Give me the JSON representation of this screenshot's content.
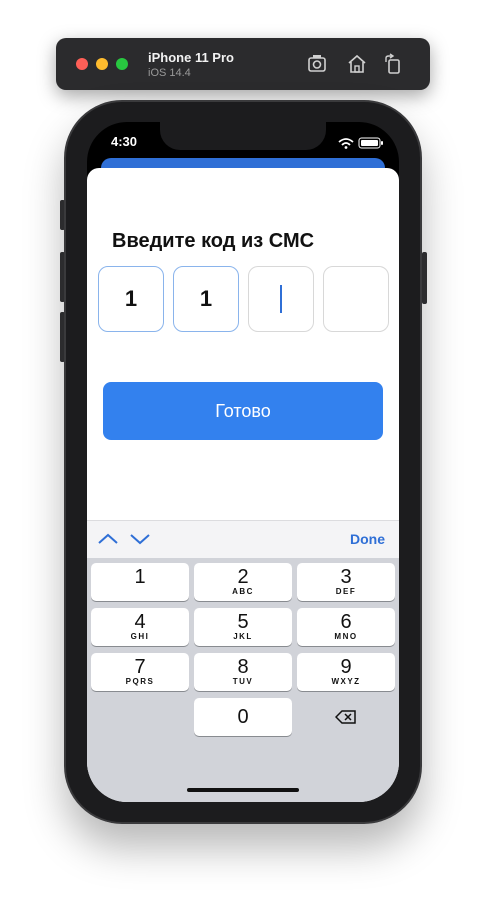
{
  "simulator": {
    "device_name": "iPhone 11 Pro",
    "os_version": "iOS 14.4",
    "buttons": [
      "screenshot-icon",
      "home-icon",
      "rotate-icon"
    ]
  },
  "status_bar": {
    "time": "4:30"
  },
  "screen": {
    "title": "Введите код из СМС",
    "otp_digits": [
      "1",
      "1",
      "",
      ""
    ],
    "submit_label": "Готово"
  },
  "keyboard": {
    "toolbar": {
      "prev_icon": "chevron-up-icon",
      "next_icon": "chevron-down-icon",
      "done_label": "Done"
    },
    "keys": [
      {
        "num": "1",
        "letters": ""
      },
      {
        "num": "2",
        "letters": "ABC"
      },
      {
        "num": "3",
        "letters": "DEF"
      },
      {
        "num": "4",
        "letters": "GHI"
      },
      {
        "num": "5",
        "letters": "JKL"
      },
      {
        "num": "6",
        "letters": "MNO"
      },
      {
        "num": "7",
        "letters": "PQRS"
      },
      {
        "num": "8",
        "letters": "TUV"
      },
      {
        "num": "9",
        "letters": "WXYZ"
      },
      {
        "num": "0",
        "letters": ""
      }
    ],
    "delete_icon": "backspace-icon"
  },
  "colors": {
    "accent": "#3381ee",
    "otp_active_border": "#8ab4ec"
  }
}
